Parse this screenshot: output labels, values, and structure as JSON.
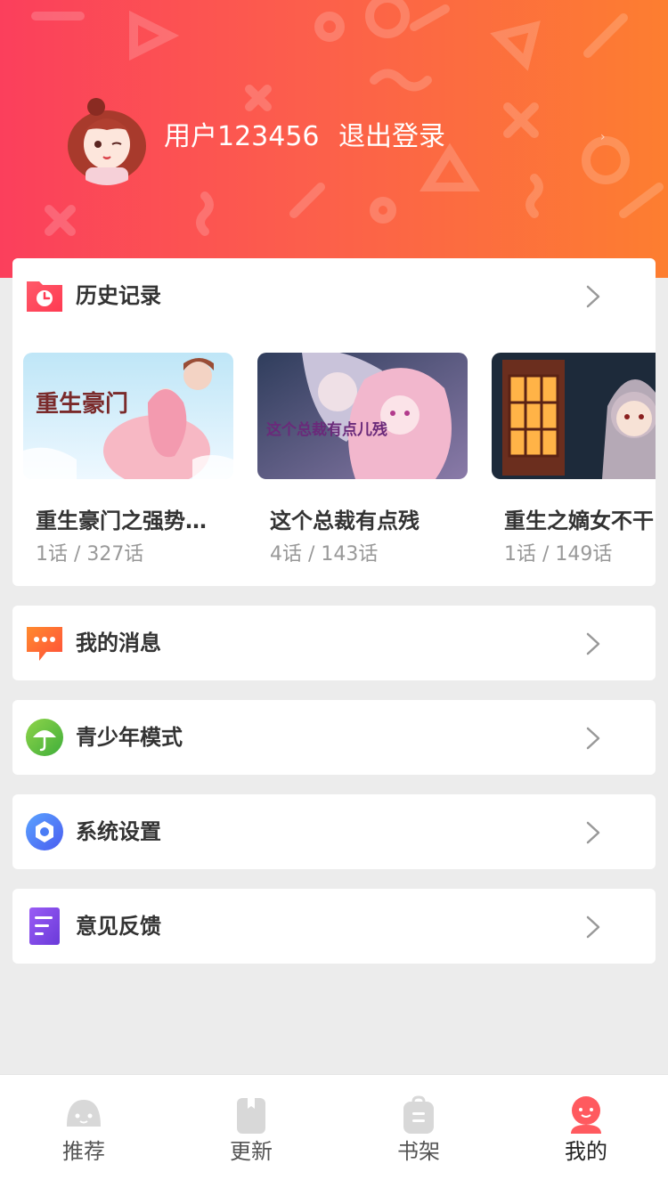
{
  "header": {
    "username": "用户123456",
    "logout_label": "退出登录"
  },
  "history": {
    "title": "历史记录",
    "icon": "clock-folder-icon",
    "items": [
      {
        "title": "重生豪门之强势…",
        "progress": "1话 / 327话",
        "cover_caption": "重生豪门"
      },
      {
        "title": "这个总裁有点残",
        "progress": "4话 / 143话",
        "cover_caption": "这个总裁有点儿残"
      },
      {
        "title": "重生之嫡女不干",
        "progress": "1话 / 149话",
        "cover_caption": ""
      }
    ]
  },
  "menu": [
    {
      "label": "我的消息",
      "icon": "message-bubble-icon"
    },
    {
      "label": "青少年模式",
      "icon": "umbrella-icon"
    },
    {
      "label": "系统设置",
      "icon": "settings-hexagon-icon"
    },
    {
      "label": "意见反馈",
      "icon": "feedback-document-icon"
    }
  ],
  "tabbar": {
    "tabs": [
      {
        "label": "推荐",
        "icon": "recommend-face-icon",
        "active": false
      },
      {
        "label": "更新",
        "icon": "book-icon",
        "active": false
      },
      {
        "label": "书架",
        "icon": "bookshelf-bag-icon",
        "active": false
      },
      {
        "label": "我的",
        "icon": "profile-icon",
        "active": true
      }
    ]
  },
  "colors": {
    "header_start": "#fb3f5c",
    "header_end": "#fd7e30",
    "accent": "#ff5a5f"
  }
}
